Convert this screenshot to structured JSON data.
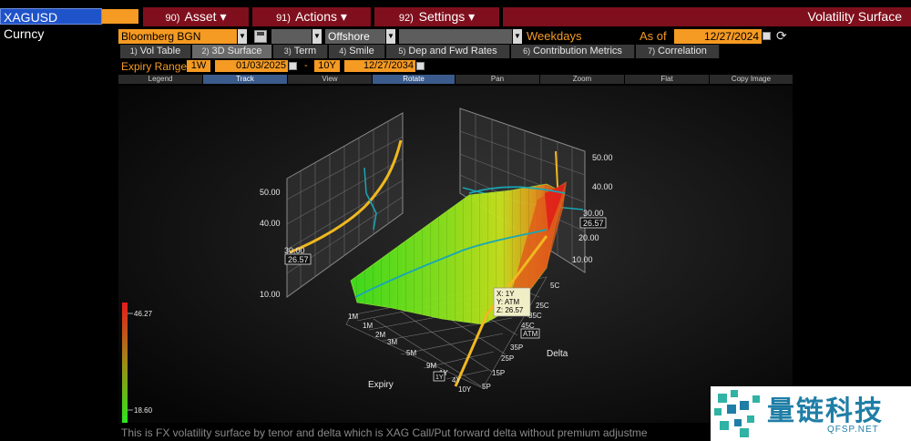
{
  "header": {
    "ticker": "XAGUSD Curncy",
    "menus": [
      {
        "num": "90)",
        "label": "Asset ▾"
      },
      {
        "num": "91)",
        "label": "Actions ▾"
      },
      {
        "num": "92)",
        "label": "Settings ▾"
      }
    ],
    "title": "Volatility Surface"
  },
  "options": {
    "source": "Bloomberg BGN",
    "location": "Offshore",
    "weekdays": "Weekdays",
    "as_of_label": "As of",
    "as_of_date": "12/27/2024"
  },
  "tabs": [
    {
      "num": "1)",
      "label": "Vol Table"
    },
    {
      "num": "2)",
      "label": "3D Surface"
    },
    {
      "num": "3)",
      "label": "Term"
    },
    {
      "num": "4)",
      "label": "Smile"
    },
    {
      "num": "5)",
      "label": "Dep and Fwd Rates"
    },
    {
      "num": "6)",
      "label": "Contribution Metrics"
    },
    {
      "num": "7)",
      "label": "Correlation"
    }
  ],
  "expiry": {
    "label": "Expiry Range",
    "start_tenor": "1W",
    "start_date": "01/03/2025",
    "dash": "-",
    "end_tenor": "10Y",
    "end_date": "12/27/2034"
  },
  "toolbar": [
    "Legend",
    "Track",
    "View",
    "Rotate",
    "Pan",
    "Zoom",
    "Flat",
    "Copy Image"
  ],
  "chart": {
    "left_panel_ticks": [
      "50.00",
      "40.00",
      "30.00",
      "10.00"
    ],
    "left_panel_marker": "26.57",
    "right_panel_ticks": [
      "50.00",
      "40.00",
      "30.00",
      "20.00",
      "10.00"
    ],
    "right_panel_marker": "26.57",
    "expiry_ticks": [
      "1M",
      "1M",
      "2M",
      "3M",
      "5M",
      "9M",
      "1Y",
      "4Y",
      "10Y"
    ],
    "expiry_marker": "1Y",
    "delta_ticks": [
      "5C",
      "25C",
      "35C",
      "45C",
      "ATM",
      "35P",
      "25P",
      "15P",
      "5P"
    ],
    "expiry_label": "Expiry",
    "delta_label": "Delta",
    "tooltip": {
      "x": "X: 1Y",
      "y": "Y: ATM",
      "z": "Z: 26.57"
    },
    "colorbar_max": "46.27",
    "colorbar_min": "18.60"
  },
  "footer": "This is FX volatility surface by tenor and delta which is XAG Call/Put forward delta without premium adjustme",
  "watermark": {
    "cn": "量链科技",
    "en": "QFSP.NET"
  },
  "colors": {
    "accent": "#f59a22",
    "menu_bg": "#7f0f1c",
    "ticker_bg": "#1f53c9"
  }
}
